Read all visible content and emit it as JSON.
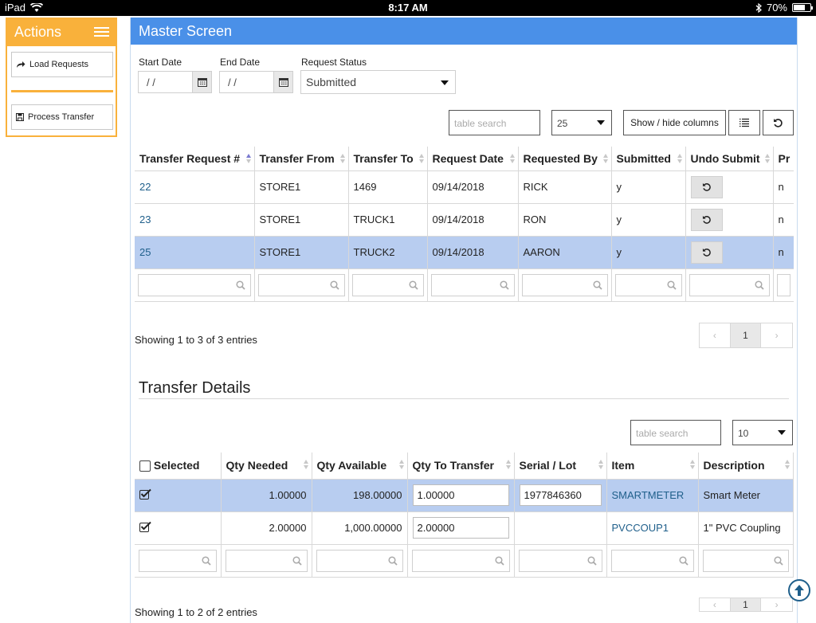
{
  "status_bar": {
    "device": "iPad",
    "time": "8:17 AM",
    "battery": "70%",
    "battery_level": 0.7
  },
  "actions": {
    "title": "Actions",
    "load_requests": "Load Requests",
    "process_transfer": "Process Transfer"
  },
  "master": {
    "title": "Master Screen",
    "start_date_label": "Start Date",
    "start_date_value": "/ /",
    "end_date_label": "End Date",
    "end_date_value": "/ /",
    "status_label": "Request Status",
    "status_value": "Submitted",
    "search_placeholder": "table search",
    "page_size": "25",
    "show_hide_label": "Show / hide columns",
    "columns": [
      "Transfer Request #",
      "Transfer From",
      "Transfer To",
      "Request Date",
      "Requested By",
      "Submitted",
      "Undo Submit",
      "Pr"
    ],
    "rows": [
      {
        "id": "22",
        "from": "STORE1",
        "to": "1469",
        "date": "09/14/2018",
        "by": "RICK",
        "submitted": "y",
        "pr": "n"
      },
      {
        "id": "23",
        "from": "STORE1",
        "to": "TRUCK1",
        "date": "09/14/2018",
        "by": "RON",
        "submitted": "y",
        "pr": "n"
      },
      {
        "id": "25",
        "from": "STORE1",
        "to": "TRUCK2",
        "date": "09/14/2018",
        "by": "AARON",
        "submitted": "y",
        "pr": "n"
      }
    ],
    "info": "Showing 1 to 3 of 3 entries",
    "pager": {
      "prev": "‹",
      "current": "1",
      "next": "›"
    }
  },
  "details": {
    "title": "Transfer Details",
    "search_placeholder": "table search",
    "page_size": "10",
    "columns": [
      "Selected",
      "Qty Needed",
      "Qty Available",
      "Qty To Transfer",
      "Serial / Lot",
      "Item",
      "Description"
    ],
    "rows": [
      {
        "qty_needed": "1.00000",
        "qty_available": "198.00000",
        "qty_transfer": "1.00000",
        "serial": "1977846360",
        "item": "SMARTMETER",
        "description": "Smart Meter"
      },
      {
        "qty_needed": "2.00000",
        "qty_available": "1,000.00000",
        "qty_transfer": "2.00000",
        "serial": "",
        "item": "PVCCOUP1",
        "description": "1\" PVC Coupling"
      }
    ],
    "info": "Showing 1 to 2 of 2 entries",
    "pager": {
      "prev": "‹",
      "current": "1",
      "next": "›"
    }
  },
  "colors": {
    "actions_accent": "#f9b13b",
    "header_blue": "#4a90e8",
    "selected_row": "#b8cdf0",
    "link": "#1f5f8b"
  }
}
